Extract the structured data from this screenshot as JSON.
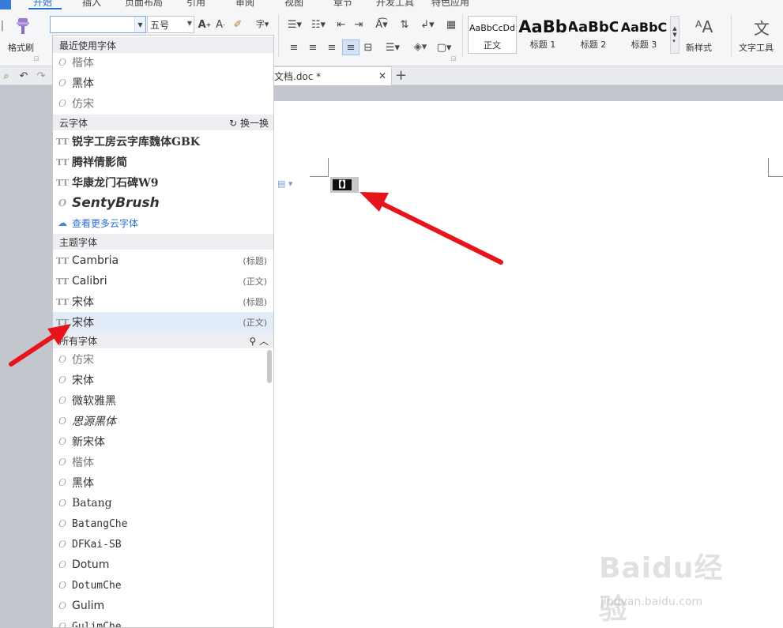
{
  "menu_tabs": [
    "开始",
    "插入",
    "页面布局",
    "引用",
    "审阅",
    "视图",
    "章节",
    "开发工具",
    "特色应用"
  ],
  "ribbon": {
    "format_painter": "格式刷",
    "font_name_value": "",
    "font_size_value": "五号",
    "styles": [
      {
        "sample": "AaBbCcDd",
        "caption": "正文"
      },
      {
        "sample": "AaBb",
        "caption": "标题 1"
      },
      {
        "sample": "AaBbC",
        "caption": "标题 2"
      },
      {
        "sample": "AaBbC",
        "caption": "标题 3"
      }
    ],
    "new_style": "新样式",
    "text_tools": "文字工具"
  },
  "document": {
    "tab_title": "文档.doc *",
    "selected_char": "【】"
  },
  "font_panel": {
    "recent_header": "最近使用字体",
    "recent": [
      "楷体",
      "黑体",
      "仿宋"
    ],
    "cloud_header": "云字体",
    "cloud_refresh": "换一换",
    "cloud": [
      "锐字工房云字库魏体GBK",
      "腾祥倩影简",
      "华康龙门石碑W9",
      "SentyBrush"
    ],
    "cloud_more": "查看更多云字体",
    "theme_header": "主题字体",
    "theme": [
      {
        "name": "Cambria",
        "tag": "(标题)"
      },
      {
        "name": "Calibri",
        "tag": "(正文)"
      },
      {
        "name": "宋体",
        "tag": "(标题)"
      },
      {
        "name": "宋体",
        "tag": "(正文)"
      }
    ],
    "all_header": "所有字体",
    "all": [
      "仿宋",
      "宋体",
      "微软雅黑",
      "思源黑体",
      "新宋体",
      "楷体",
      "黑体",
      "Batang",
      "BatangChe",
      "DFKai-SB",
      "Dotum",
      "DotumChe",
      "Gulim",
      "GulimChe"
    ]
  },
  "watermark": {
    "text": "Baidu经验",
    "sub": "jingyan.baidu.com"
  },
  "colors": {
    "accent": "#2b6fd1",
    "highlight": "#e2ebf8",
    "arrow": "#e8141b"
  }
}
